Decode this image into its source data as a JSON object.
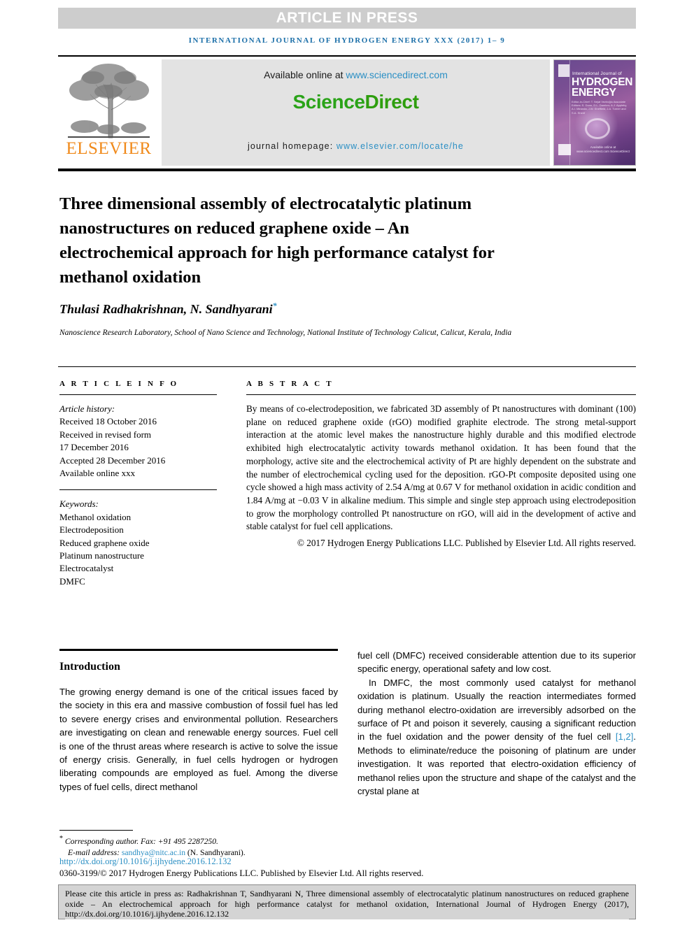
{
  "banner": {
    "text": "ARTICLE IN PRESS"
  },
  "running_head": {
    "text": "INTERNATIONAL JOURNAL OF HYDROGEN ENERGY XXX (2017) 1– 9"
  },
  "masthead": {
    "available_prefix": "Available online at ",
    "available_link": "www.sciencedirect.com",
    "sciencedirect_part1": "Science",
    "sciencedirect_part2": "Direct",
    "homepage_prefix": "journal homepage: ",
    "homepage_link": "www.elsevier.com/locate/he",
    "publisher_name": "ELSEVIER",
    "cover": {
      "line_small": "International Journal of",
      "line1": "HYDROGEN",
      "line2": "ENERGY",
      "editor_block": "Editor-in-Chief: T. Nejat Veziroğlu    Associate Editors: S. Dunn, D.L. Damkov, A.J. Appleby, A.I. Miranda, J.W. Sheffield, J.A. Turner and S.A. Sherif",
      "sciencedirect_tag": "Available online at www.sciencedirect.com  ScienceDirect"
    }
  },
  "article": {
    "title": "Three dimensional assembly of electrocatalytic platinum nanostructures on reduced graphene oxide – An electrochemical approach for high performance catalyst for methanol oxidation",
    "authors": "Thulasi Radhakrishnan, N. Sandhyarani",
    "author_marker": "*",
    "affiliation": "Nanoscience Research Laboratory, School of Nano Science and Technology, National Institute of Technology Calicut, Calicut, Kerala, India"
  },
  "article_info": {
    "heading": "A R T I C L E   I N F O",
    "history_label": "Article history:",
    "history": [
      "Received 18 October 2016",
      "Received in revised form",
      "17 December 2016",
      "Accepted 28 December 2016",
      "Available online xxx"
    ],
    "keywords_label": "Keywords:",
    "keywords": [
      "Methanol oxidation",
      "Electrodeposition",
      "Reduced graphene oxide",
      "Platinum nanostructure",
      "Electrocatalyst",
      "DMFC"
    ]
  },
  "abstract": {
    "heading": "A B S T R A C T",
    "text": "By means of co-electrodeposition, we fabricated 3D assembly of Pt nanostructures with dominant (100) plane on reduced graphene oxide (rGO) modified graphite electrode. The strong metal-support interaction at the atomic level makes the nanostructure highly durable and this modified electrode exhibited high electrocatalytic activity towards methanol oxidation. It has been found that the morphology, active site and the electrochemical activity of Pt are highly dependent on the substrate and the number of electrochemical cycling used for the deposition. rGO-Pt composite deposited using one cycle showed a high mass activity of 2.54 A/mg at 0.67 V for methanol oxidation in acidic condition and 1.84 A/mg at −0.03 V in alkaline medium. This simple and single step approach using electrodeposition to grow the morphology controlled Pt nanostructure on rGO, will aid in the development of active and stable catalyst for fuel cell applications.",
    "copyright": "© 2017 Hydrogen Energy Publications LLC. Published by Elsevier Ltd. All rights reserved."
  },
  "introduction": {
    "heading": "Introduction",
    "para1": "The growing energy demand is one of the critical issues faced by the society in this era and massive combustion of fossil fuel has led to severe energy crises and environmental pollution. Researchers are investigating on clean and renewable energy sources. Fuel cell is one of the thrust areas where research is active to solve the issue of energy crisis. Generally, in fuel cells hydrogen or hydrogen liberating compounds are employed as fuel. Among the diverse types of fuel cells, direct methanol",
    "para1_cont": "fuel cell (DMFC) received considerable attention due to its superior specific energy, operational safety and low cost.",
    "para2_a": "In DMFC, the most commonly used catalyst for methanol oxidation is platinum. Usually the reaction intermediates formed during methanol electro-oxidation are irreversibly adsorbed on the surface of Pt and poison it severely, causing a significant reduction in the fuel oxidation and the power density of the fuel cell ",
    "para2_ref": "[1,2]",
    "para2_b": ". Methods to eliminate/reduce the poisoning of platinum are under investigation. It was reported that electro-oxidation efficiency of methanol relies upon the structure and shape of the catalyst and the crystal plane at"
  },
  "footnote": {
    "marker": "*",
    "corresponding": "Corresponding author. Fax: +91 495 2287250.",
    "email_label": "E-mail address: ",
    "email": "sandhya@nitc.ac.in",
    "email_suffix": " (N. Sandhyarani).",
    "doi": "http://dx.doi.org/10.1016/j.ijhydene.2016.12.132",
    "issn": "0360-3199/© 2017 Hydrogen Energy Publications LLC. Published by Elsevier Ltd. All rights reserved."
  },
  "cite_box": {
    "text": "Please cite this article in press as: Radhakrishnan T, Sandhyarani N, Three dimensional assembly of electrocatalytic platinum nanostructures on reduced graphene oxide – An electrochemical approach for high performance catalyst for methanol oxidation, International Journal of Hydrogen Energy (2017), http://dx.doi.org/10.1016/j.ijhydene.2016.12.132"
  },
  "colors": {
    "banner_bg": "#cdcdcd",
    "running_head": "#1a6ea8",
    "link": "#2b8fc4",
    "sciencedirect_green": "#2aa318",
    "elsevier_orange": "#f08a1b",
    "cite_box_bg": "#d4d4d4"
  }
}
